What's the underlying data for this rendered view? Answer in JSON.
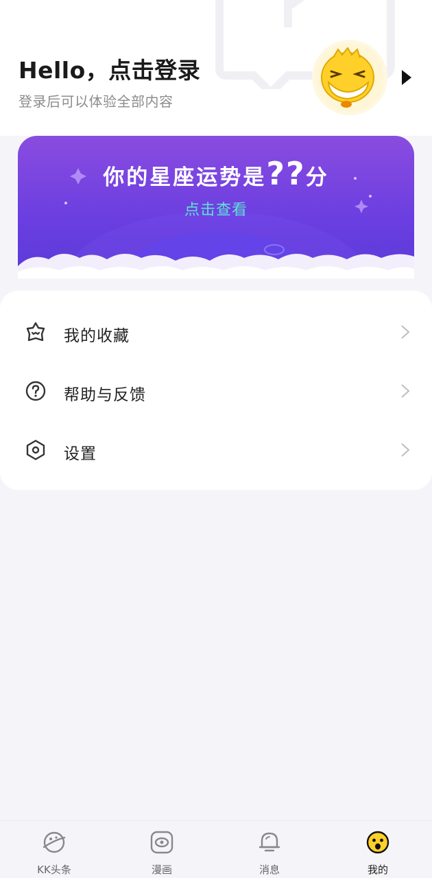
{
  "header": {
    "title": "Hello，点击登录",
    "subtitle": "登录后可以体验全部内容"
  },
  "banner": {
    "title_prefix": "你的星座运势是",
    "title_score": "??",
    "title_suffix": "分",
    "cta": "点击查看"
  },
  "menu": {
    "items": [
      {
        "label": "我的收藏",
        "icon": "favorite-star-icon"
      },
      {
        "label": "帮助与反馈",
        "icon": "help-question-icon"
      },
      {
        "label": "设置",
        "icon": "settings-hexagon-icon"
      }
    ]
  },
  "tabbar": {
    "tabs": [
      {
        "label": "KK头条",
        "icon": "planet-icon"
      },
      {
        "label": "漫画",
        "icon": "eye-frame-icon"
      },
      {
        "label": "消息",
        "icon": "bell-icon"
      },
      {
        "label": "我的",
        "icon": "smiley-face-icon",
        "active": true
      }
    ]
  },
  "colors": {
    "banner_start": "#8a4ce0",
    "banner_end": "#5b3ad8",
    "cta": "#5fe0d6",
    "avatar_yellow": "#ffd02a"
  }
}
